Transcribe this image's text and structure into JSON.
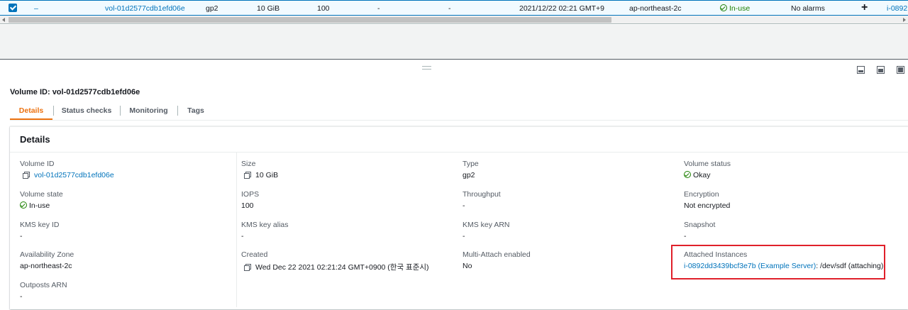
{
  "top_row": {
    "state_dash": "–",
    "volume_id": "vol-01d2577cdb1efd06e",
    "type": "gp2",
    "size": "10 GiB",
    "iops": "100",
    "col_a": "-",
    "col_b": "-",
    "created": "2021/12/22 02:21 GMT+9",
    "zone": "ap-northeast-2c",
    "state": "In-use",
    "alarms": "No alarms",
    "plus": "+",
    "instance": "i-0892"
  },
  "volume_title": "Volume ID: vol-01d2577cdb1efd06e",
  "tabs": [
    {
      "label": "Details"
    },
    {
      "label": "Status checks"
    },
    {
      "label": "Monitoring"
    },
    {
      "label": "Tags"
    }
  ],
  "panel_title": "Details",
  "columns": [
    [
      {
        "label": "Volume ID",
        "value": "vol-01d2577cdb1efd06e"
      },
      {
        "label": "Volume state",
        "value": "In-use"
      },
      {
        "label": "KMS key ID",
        "value": "-"
      },
      {
        "label": "Availability Zone",
        "value": "ap-northeast-2c"
      },
      {
        "label": "Outposts ARN",
        "value": "-"
      }
    ],
    [
      {
        "label": "Size",
        "value": "10 GiB"
      },
      {
        "label": "IOPS",
        "value": "100"
      },
      {
        "label": "KMS key alias",
        "value": "-"
      },
      {
        "label": "Created",
        "value": "Wed Dec 22 2021 02:21:24 GMT+0900 (한국 표준시)"
      }
    ],
    [
      {
        "label": "Type",
        "value": "gp2"
      },
      {
        "label": "Throughput",
        "value": "-"
      },
      {
        "label": "KMS key ARN",
        "value": "-"
      },
      {
        "label": "Multi-Attach enabled",
        "value": "No"
      }
    ],
    [
      {
        "label": "Volume status",
        "value": "Okay"
      },
      {
        "label": "Encryption",
        "value": "Not encrypted"
      },
      {
        "label": "Snapshot",
        "value": "-"
      },
      {
        "label": "Attached Instances",
        "instance_link": "i-0892dd3439bcf3e7b (Example Server)",
        "suffix": ": /dev/sdf (attaching)"
      }
    ]
  ],
  "colors": {
    "accent": "#0073bb",
    "success": "#1d8102",
    "active_tab": "#ec7211",
    "highlight": "#e0202a"
  }
}
